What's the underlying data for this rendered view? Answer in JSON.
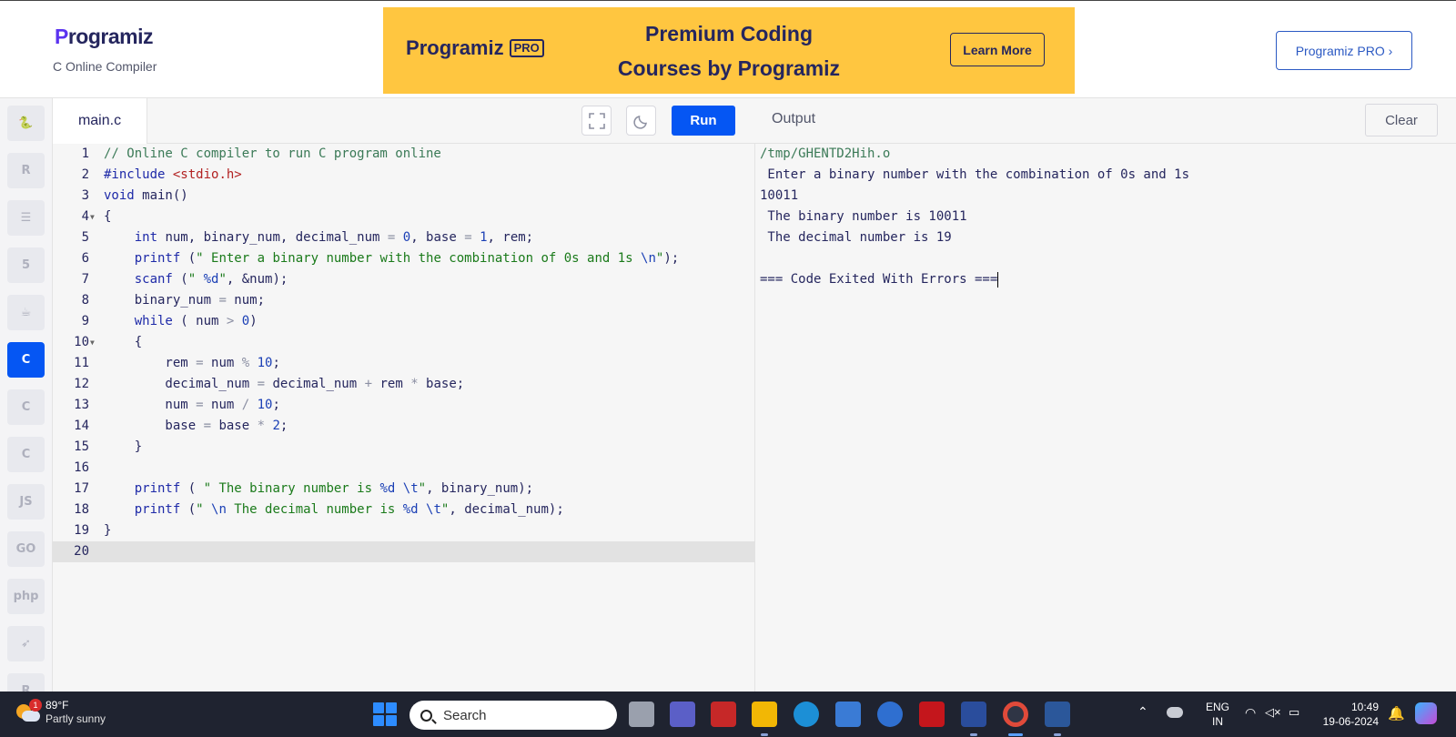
{
  "header": {
    "logo_text": "rogramiz",
    "logo_initial": "P",
    "subtitle": "C Online Compiler",
    "banner": {
      "logo_text": "rogramiz",
      "logo_initial": "P",
      "logo_badge": "PRO",
      "headline_line1": "Premium Coding",
      "headline_line2": "Courses by Programiz",
      "cta": "Learn More"
    },
    "pro_button": "Programiz PRO ›"
  },
  "rail": {
    "items": [
      {
        "icon": "python-icon",
        "glyph": "🐍"
      },
      {
        "icon": "r-icon",
        "glyph": "R"
      },
      {
        "icon": "sql-icon",
        "glyph": "☰"
      },
      {
        "icon": "html-icon",
        "glyph": "5"
      },
      {
        "icon": "java-icon",
        "glyph": "☕"
      },
      {
        "icon": "c-icon",
        "glyph": "C",
        "active": true
      },
      {
        "icon": "cpp-icon",
        "glyph": "C"
      },
      {
        "icon": "csharp-icon",
        "glyph": "C"
      },
      {
        "icon": "js-icon",
        "glyph": "JS"
      },
      {
        "icon": "go-icon",
        "glyph": "GO"
      },
      {
        "icon": "php-icon",
        "glyph": "php"
      },
      {
        "icon": "swift-icon",
        "glyph": "➶"
      },
      {
        "icon": "rust-icon",
        "glyph": "R"
      }
    ]
  },
  "editor": {
    "filename": "main.c",
    "run_label": "Run",
    "lines": [
      {
        "n": "1",
        "code": "// Online C compiler to run C program online"
      },
      {
        "n": "2",
        "code": "#include <stdio.h>"
      },
      {
        "n": "3",
        "code": "void main()"
      },
      {
        "n": "4",
        "code": "{",
        "fold": true
      },
      {
        "n": "5",
        "code": "    int num, binary_num, decimal_num = 0, base = 1, rem;"
      },
      {
        "n": "6",
        "code": "    printf (\" Enter a binary number with the combination of 0s and 1s \\n\");"
      },
      {
        "n": "7",
        "code": "    scanf (\" %d\", &num);"
      },
      {
        "n": "8",
        "code": "    binary_num = num;"
      },
      {
        "n": "9",
        "code": "    while ( num > 0)"
      },
      {
        "n": "10",
        "code": "    {",
        "fold": true
      },
      {
        "n": "11",
        "code": "        rem = num % 10;"
      },
      {
        "n": "12",
        "code": "        decimal_num = decimal_num + rem * base;"
      },
      {
        "n": "13",
        "code": "        num = num / 10;"
      },
      {
        "n": "14",
        "code": "        base = base * 2;"
      },
      {
        "n": "15",
        "code": "    }"
      },
      {
        "n": "16",
        "code": ""
      },
      {
        "n": "17",
        "code": "    printf ( \" The binary number is %d \\t\", binary_num);"
      },
      {
        "n": "18",
        "code": "    printf (\" \\n The decimal number is %d \\t\", decimal_num);"
      },
      {
        "n": "19",
        "code": "}"
      },
      {
        "n": "20",
        "code": "",
        "current": true
      }
    ]
  },
  "output": {
    "title": "Output",
    "clear_label": "Clear",
    "lines": [
      "/tmp/GHENTD2Hih.o",
      " Enter a binary number with the combination of 0s and 1s",
      "10011",
      " The binary number is 10011",
      " The decimal number is 19",
      "",
      "=== Code Exited With Errors ==="
    ]
  },
  "taskbar": {
    "weather_temp": "89°F",
    "weather_desc": "Partly sunny",
    "weather_badge": "1",
    "search_label": "Search",
    "lang_line1": "ENG",
    "lang_line2": "IN",
    "time": "10:49",
    "date": "19-06-2024"
  },
  "colors": {
    "accent": "#0556f3",
    "banner": "#ffc640",
    "brand_text": "#25265e"
  }
}
